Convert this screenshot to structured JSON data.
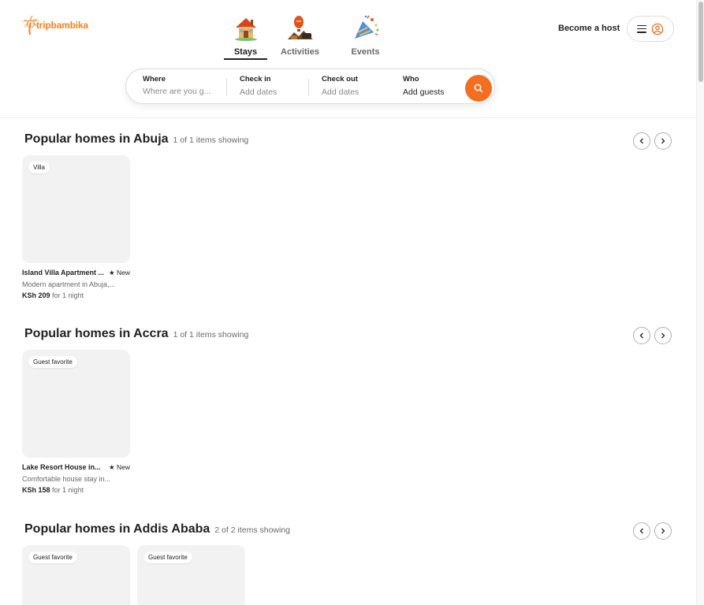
{
  "logo": {
    "text": "tripbambika",
    "icon": "palm-tree-icon",
    "color": "#f5821f"
  },
  "categories": [
    {
      "label": "Stays",
      "icon": "house-icon",
      "active": true
    },
    {
      "label": "Activities",
      "icon": "hot-air-balloon-icon",
      "active": false
    },
    {
      "label": "Events",
      "icon": "party-popper-icon",
      "active": false
    }
  ],
  "header": {
    "host_label": "Become a host",
    "menu_icon": "hamburger-menu-icon",
    "user_icon": "user-circle-icon"
  },
  "search": {
    "where": {
      "label": "Where",
      "placeholder": "Where are you g..."
    },
    "checkin": {
      "label": "Check in",
      "value": "Add dates"
    },
    "checkout": {
      "label": "Check out",
      "value": "Add dates"
    },
    "who": {
      "label": "Who",
      "value": "Add guests"
    },
    "button_icon": "search-icon",
    "accent": "#f26f21"
  },
  "sections": [
    {
      "title": "Popular homes in Abuja",
      "count": "1 of 1 items showing",
      "cards": [
        {
          "badge": "Villa",
          "name": "Island Villa Apartment ...",
          "rating": "★ New",
          "desc": "Modern apartment in Abuja,...",
          "price": "KSh 209",
          "per": "for 1 night"
        }
      ]
    },
    {
      "title": "Popular homes in Accra",
      "count": "1 of 1 items showing",
      "cards": [
        {
          "badge": "Guest favorite",
          "name": "Lake Resort House in...",
          "rating": "★ New",
          "desc": "Comfortable house stay in...",
          "price": "KSh 158",
          "per": "for 1 night"
        }
      ]
    },
    {
      "title": "Popular homes in Addis Ababa",
      "count": "2 of 2 items showing",
      "cards": [
        {
          "badge": "Guest favorite"
        },
        {
          "badge": "Guest favorite"
        }
      ]
    }
  ],
  "nav_icons": {
    "prev": "chevron-left-icon",
    "next": "chevron-right-icon"
  }
}
